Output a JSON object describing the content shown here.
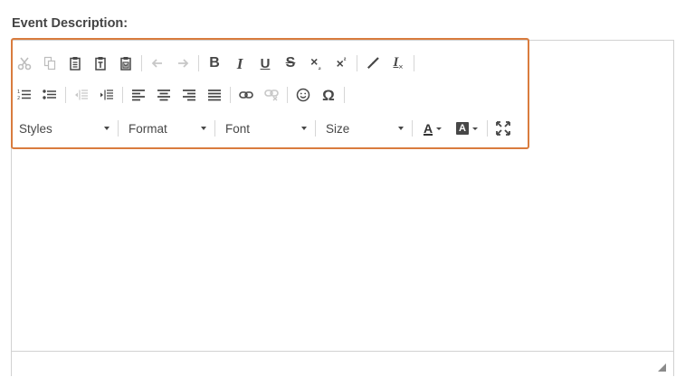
{
  "field": {
    "label": "Event Description:"
  },
  "toolbar": {
    "combos": {
      "styles": "Styles",
      "format": "Format",
      "font": "Font",
      "size": "Size"
    },
    "special_char": "Ω",
    "accent_color": "#d97c3e"
  },
  "editor": {
    "content": ""
  }
}
